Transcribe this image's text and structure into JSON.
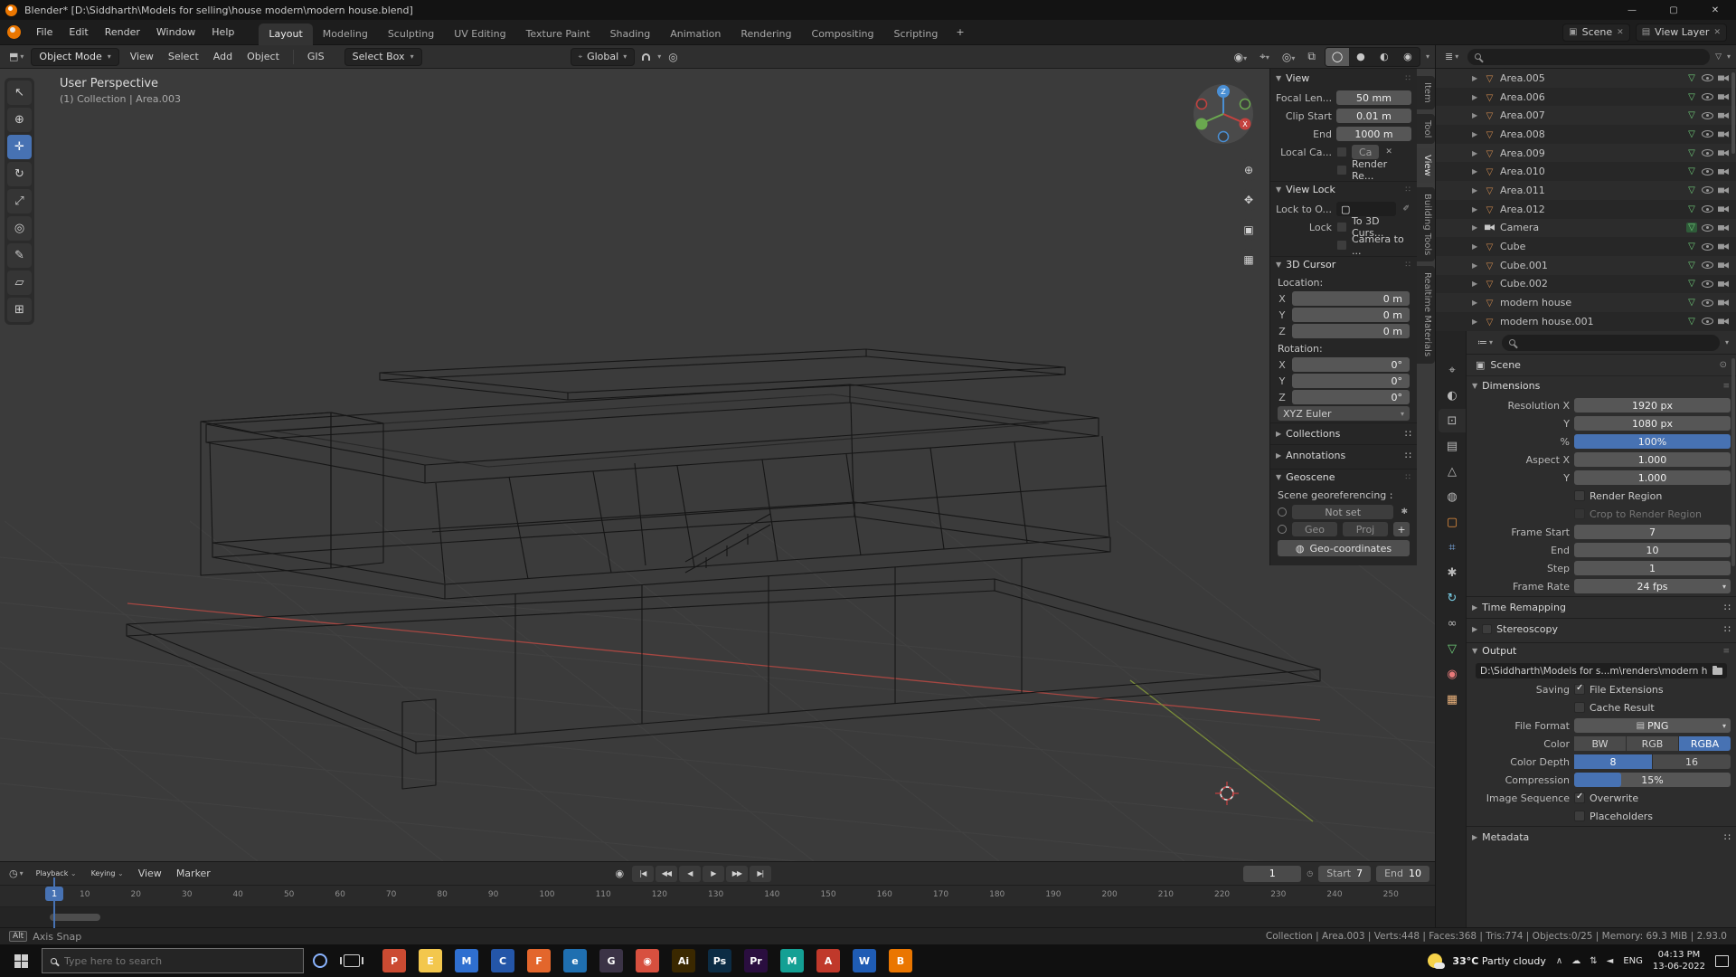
{
  "accent": "#4772b3",
  "titlebar": {
    "title": "Blender* [D:\\Siddharth\\Models for selling\\house modern\\modern house.blend]",
    "minimize": "—",
    "maximize": "▢",
    "close": "✕"
  },
  "topbar": {
    "menus": [
      {
        "label": "File"
      },
      {
        "label": "Edit"
      },
      {
        "label": "Render"
      },
      {
        "label": "Window"
      },
      {
        "label": "Help"
      }
    ],
    "workspaces": [
      {
        "label": "Layout",
        "active": true
      },
      {
        "label": "Modeling"
      },
      {
        "label": "Sculpting"
      },
      {
        "label": "UV Editing"
      },
      {
        "label": "Texture Paint"
      },
      {
        "label": "Shading"
      },
      {
        "label": "Animation"
      },
      {
        "label": "Rendering"
      },
      {
        "label": "Compositing"
      },
      {
        "label": "Scripting"
      }
    ],
    "add_workspace": "+",
    "scene_label": "Scene",
    "view_layer_label": "View Layer"
  },
  "toolheader": {
    "mode": "Object Mode",
    "menus": [
      {
        "label": "View"
      },
      {
        "label": "Select"
      },
      {
        "label": "Add"
      },
      {
        "label": "Object"
      }
    ],
    "gis": "GIS",
    "select_tool": "Select Box",
    "orientation": "Global"
  },
  "tools": [
    {
      "name": "select-box-tool",
      "glyph": "↖"
    },
    {
      "name": "cursor-tool",
      "glyph": "⊕"
    },
    {
      "name": "move-tool",
      "glyph": "✛",
      "active": true
    },
    {
      "name": "rotate-tool",
      "glyph": "↻"
    },
    {
      "name": "scale-tool",
      "glyph": "⤢"
    },
    {
      "name": "transform-tool",
      "glyph": "◎"
    },
    {
      "name": "annotate-tool",
      "glyph": "✎"
    },
    {
      "name": "measure-tool",
      "glyph": "▱"
    },
    {
      "name": "add-cube-tool",
      "glyph": "⊞"
    }
  ],
  "viewport": {
    "perspective": "User Perspective",
    "collection": "(1) Collection | Area.003",
    "axis_z": "Z",
    "axis_x": "X",
    "nav": [
      {
        "name": "zoom-icon",
        "glyph": "⊕"
      },
      {
        "name": "pan-hand-icon",
        "glyph": "✥"
      },
      {
        "name": "camera-view-icon",
        "glyph": "▣"
      },
      {
        "name": "ortho-grid-icon",
        "glyph": "▦"
      }
    ]
  },
  "npanel": {
    "tabs": [
      {
        "label": "Item"
      },
      {
        "label": "Tool"
      },
      {
        "label": "View",
        "active": true
      },
      {
        "label": "Building Tools"
      },
      {
        "label": "Realtime Materials"
      }
    ],
    "view": {
      "title": "View",
      "rows": [
        {
          "label": "Focal Len...",
          "value": "50 mm"
        },
        {
          "label": "Clip Start",
          "value": "0.01 m"
        },
        {
          "label": "End",
          "value": "1000 m"
        }
      ],
      "local_camera": {
        "label": "Local Ca...",
        "value": "Ca",
        "clear": "✕"
      },
      "render_region": "Render Re..."
    },
    "view_lock": {
      "title": "View Lock",
      "lock_to_label": "Lock to O...",
      "lock_label": "Lock",
      "opt_cursor": "To 3D Curs...",
      "opt_camera": "Camera to ..."
    },
    "cursor3d": {
      "title": "3D Cursor",
      "location_label": "Location:",
      "location": [
        {
          "label": "X",
          "value": "0 m"
        },
        {
          "label": "Y",
          "value": "0 m"
        },
        {
          "label": "Z",
          "value": "0 m"
        }
      ],
      "rotation_label": "Rotation:",
      "rotation": [
        {
          "label": "X",
          "value": "0°"
        },
        {
          "label": "Y",
          "value": "0°"
        },
        {
          "label": "Z",
          "value": "0°"
        }
      ],
      "euler": "XYZ Euler"
    },
    "collapsed": [
      {
        "label": "Collections"
      },
      {
        "label": "Annotations"
      }
    ],
    "geoscene": {
      "title": "Geoscene",
      "georef": "Scene georeferencing :",
      "status": "Not set",
      "geo": "Geo",
      "proj": "Proj",
      "add": "+",
      "coords": "Geo-coordinates"
    }
  },
  "outliner": {
    "rows": [
      {
        "name": "Area.005",
        "icon": "mesh-object-icon"
      },
      {
        "name": "Area.006",
        "icon": "mesh-object-icon"
      },
      {
        "name": "Area.007",
        "icon": "mesh-object-icon"
      },
      {
        "name": "Area.008",
        "icon": "mesh-object-icon"
      },
      {
        "name": "Area.009",
        "icon": "mesh-object-icon"
      },
      {
        "name": "Area.010",
        "icon": "mesh-object-icon"
      },
      {
        "name": "Area.011",
        "icon": "mesh-object-icon"
      },
      {
        "name": "Area.012",
        "icon": "mesh-object-icon"
      },
      {
        "name": "Camera",
        "icon": "camera-object-icon",
        "is_camera": true
      },
      {
        "name": "Cube",
        "icon": "mesh-object-icon"
      },
      {
        "name": "Cube.001",
        "icon": "mesh-object-icon"
      },
      {
        "name": "Cube.002",
        "icon": "mesh-object-icon"
      },
      {
        "name": "modern house",
        "icon": "mesh-object-icon"
      },
      {
        "name": "modern house.001",
        "icon": "mesh-object-icon"
      }
    ]
  },
  "props": {
    "tabs": [
      {
        "name": "tool-tab",
        "glyph": "⌖"
      },
      {
        "name": "render-tab",
        "glyph": "◐"
      },
      {
        "name": "output-tab",
        "glyph": "⊡",
        "active": true
      },
      {
        "name": "view-layer-tab",
        "glyph": "▤"
      },
      {
        "name": "scene-tab",
        "glyph": "△"
      },
      {
        "name": "world-tab",
        "glyph": "◍"
      },
      {
        "name": "object-tab",
        "glyph": "▢",
        "color": "#e8913f"
      },
      {
        "name": "modifiers-tab",
        "glyph": "⌗",
        "color": "#7aa7dd"
      },
      {
        "name": "particles-tab",
        "glyph": "✱"
      },
      {
        "name": "physics-tab",
        "glyph": "↻",
        "color": "#7ad0e8"
      },
      {
        "name": "constraints-tab",
        "glyph": "∞"
      },
      {
        "name": "object-data-tab",
        "glyph": "▽",
        "color": "#6fce7a"
      },
      {
        "name": "material-tab",
        "glyph": "◉",
        "color": "#e87a7a"
      },
      {
        "name": "texture-tab",
        "glyph": "▦",
        "color": "#e8b07a"
      }
    ],
    "breadcrumb": "Scene",
    "dimensions": {
      "title": "Dimensions",
      "rows": [
        {
          "label": "Resolution X",
          "value": "1920 px"
        },
        {
          "label": "Y",
          "value": "1080 px"
        },
        {
          "label": "%",
          "value": "100%",
          "slider": true,
          "fill": "100%"
        },
        {
          "label": "Aspect X",
          "value": "1.000"
        },
        {
          "label": "Y",
          "value": "1.000"
        },
        {
          "label": "",
          "value": "Render Region",
          "check": true
        },
        {
          "label": "",
          "value": "Crop to Render Region",
          "check": true,
          "disabled": true
        },
        {
          "label": "Frame Start",
          "value": "7"
        },
        {
          "label": "End",
          "value": "10"
        },
        {
          "label": "Step",
          "value": "1"
        },
        {
          "label": "Frame Rate",
          "value": "24 fps",
          "dropdown": true
        }
      ]
    },
    "collapsed_1": [
      {
        "label": "Time Remapping"
      },
      {
        "label": "Stereoscopy",
        "check": true
      }
    ],
    "output": {
      "title": "Output",
      "path": "D:\\Siddharth\\Models for s...m\\renders\\modern house",
      "rows": [
        {
          "label": "Saving",
          "value": "File Extensions",
          "check": true,
          "checked": true
        },
        {
          "label": "",
          "value": "Cache Result",
          "check": true
        }
      ],
      "file_format_label": "File Format",
      "file_format": "PNG",
      "color_label": "Color",
      "color_options": [
        {
          "label": "BW"
        },
        {
          "label": "RGB"
        },
        {
          "label": "RGBA",
          "active": true
        }
      ],
      "depth_label": "Color Depth",
      "depth_options": [
        {
          "label": "8",
          "active": true
        },
        {
          "label": "16"
        }
      ],
      "compression_label": "Compression",
      "compression": "15%",
      "compression_fill": "30%",
      "rows2": [
        {
          "label": "Image Sequence",
          "value": "Overwrite",
          "check": true,
          "checked": true
        },
        {
          "label": "",
          "value": "Placeholders",
          "check": true
        }
      ]
    },
    "metadata": "Metadata"
  },
  "timeline": {
    "menus": [
      {
        "label": "Playback",
        "caret": true
      },
      {
        "label": "Keying",
        "caret": true
      },
      {
        "label": "View"
      },
      {
        "label": "Marker"
      }
    ],
    "controls": [
      {
        "name": "auto-keying-button",
        "glyph": "◉",
        "rec": true
      },
      {
        "name": "jump-start-button",
        "glyph": "|◀"
      },
      {
        "name": "prev-keyframe-button",
        "glyph": "◀◀"
      },
      {
        "name": "play-reverse-button",
        "glyph": "◀"
      },
      {
        "name": "play-button",
        "glyph": "▶"
      },
      {
        "name": "next-keyframe-button",
        "glyph": "▶▶"
      },
      {
        "name": "jump-end-button",
        "glyph": "▶|"
      }
    ],
    "current_frame": "1",
    "playhead": "1",
    "start_label": "Start",
    "start": "7",
    "end_label": "End",
    "end": "10",
    "ticks": [
      "10",
      "20",
      "30",
      "40",
      "50",
      "60",
      "70",
      "80",
      "90",
      "100",
      "110",
      "120",
      "130",
      "140",
      "150",
      "160",
      "170",
      "180",
      "190",
      "200",
      "210",
      "220",
      "230",
      "240",
      "250"
    ]
  },
  "status": {
    "key": "Alt",
    "hint": "Axis Snap",
    "info": "Collection | Area.003 | Verts:448 | Faces:368 | Tris:774 | Objects:0/25 | Memory: 69.3 MiB | 2.93.0"
  },
  "taskbar": {
    "search_placeholder": "Type here to search",
    "apps": [
      {
        "name": "powerpoint-icon",
        "abbr": "P",
        "bg": "#cb4b32"
      },
      {
        "name": "file-explorer-icon",
        "abbr": "E",
        "bg": "#f3c74d"
      },
      {
        "name": "mail-icon",
        "abbr": "M",
        "bg": "#2f6fd0"
      },
      {
        "name": "calendar-icon",
        "abbr": "C",
        "bg": "#2456a8"
      },
      {
        "name": "firefox-icon",
        "abbr": "F",
        "bg": "#e3662c"
      },
      {
        "name": "edge-icon",
        "abbr": "e",
        "bg": "#1f6fb0"
      },
      {
        "name": "github-desktop-icon",
        "abbr": "G",
        "bg": "#3b3346"
      },
      {
        "name": "chrome-icon",
        "abbr": "◉",
        "bg": "#d7503f"
      },
      {
        "name": "illustrator-icon",
        "abbr": "Ai",
        "bg": "#3a2800"
      },
      {
        "name": "photoshop-icon",
        "abbr": "Ps",
        "bg": "#0c2c44"
      },
      {
        "name": "premiere-icon",
        "abbr": "Pr",
        "bg": "#2a0e3f"
      },
      {
        "name": "maya-icon",
        "abbr": "M",
        "bg": "#14a094"
      },
      {
        "name": "autocad-icon",
        "abbr": "A",
        "bg": "#c0392b"
      },
      {
        "name": "word-icon",
        "abbr": "W",
        "bg": "#1f5cb4"
      },
      {
        "name": "blender-icon",
        "abbr": "B",
        "bg": "#ea7600"
      }
    ],
    "tray_icons": [
      {
        "name": "tray-expand-icon",
        "glyph": "∧"
      },
      {
        "name": "onedrive-icon",
        "glyph": "☁"
      },
      {
        "name": "network-icon",
        "glyph": "⇅"
      },
      {
        "name": "volume-icon",
        "glyph": "◄"
      }
    ],
    "weather_temp": "33°C",
    "weather_desc": "Partly cloudy",
    "lang": "ENG",
    "time": "04:13 PM",
    "date": "13-06-2022"
  }
}
